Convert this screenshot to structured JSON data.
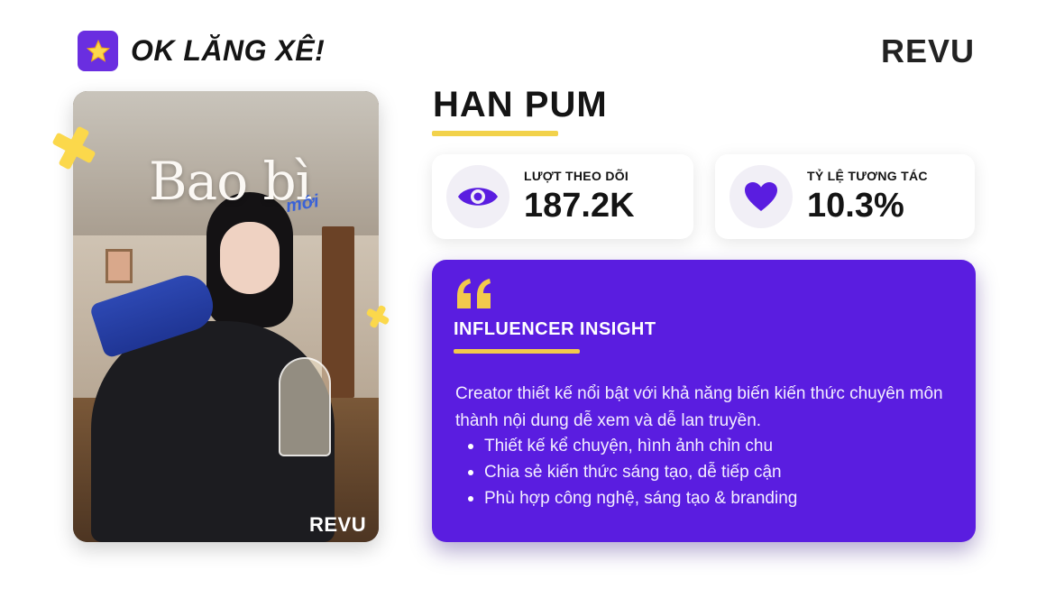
{
  "header": {
    "brand_title": "OK LĂNG XÊ!",
    "brand_icon": "star-icon",
    "logo": "REVU"
  },
  "photo": {
    "overlay_title": "Bao bì",
    "overlay_subtitle": "mới",
    "logo": "REVU"
  },
  "profile": {
    "name": "HAN PUM"
  },
  "stats": [
    {
      "label": "LƯỢT THEO DÕI",
      "value": "187.2K",
      "icon": "eye-icon"
    },
    {
      "label": "TỶ LỆ TƯƠNG TÁC",
      "value": "10.3%",
      "icon": "heart-icon"
    }
  ],
  "insight": {
    "icon": "quote-icon",
    "title": "INFLUENCER INSIGHT",
    "description": "Creator thiết kế nổi bật với khả năng biến kiến thức chuyên môn thành nội dung dễ xem và dễ lan truyền.",
    "bullets": [
      "Thiết kế kể chuyện, hình ảnh chỉn chu",
      "Chia sẻ kiến thức sáng tạo, dễ tiếp cận",
      "Phù hợp công nghệ, sáng tạo & branding"
    ]
  },
  "colors": {
    "accent_purple": "#5a1de0",
    "accent_yellow": "#f2d24b",
    "icon_purple": "#5a1de0"
  }
}
